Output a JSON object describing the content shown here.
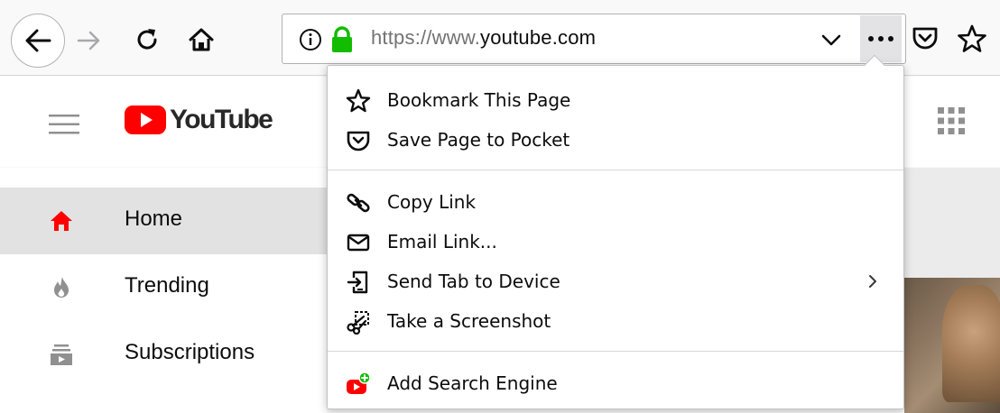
{
  "toolbar": {
    "url_scheme": "https://",
    "url_prefix": "www.",
    "url_domain": "youtube",
    "url_suffix": ".com"
  },
  "youtube": {
    "logo_text": "YouTube",
    "sidebar": [
      {
        "label": "Home",
        "icon": "home-icon",
        "active": true
      },
      {
        "label": "Trending",
        "icon": "trending-flame-icon",
        "active": false
      },
      {
        "label": "Subscriptions",
        "icon": "subscriptions-icon",
        "active": false
      }
    ]
  },
  "menu": {
    "items": [
      {
        "label": "Bookmark This Page",
        "icon": "star-icon"
      },
      {
        "label": "Save Page to Pocket",
        "icon": "pocket-icon"
      },
      {
        "label": "Copy Link",
        "icon": "link-icon"
      },
      {
        "label": "Email Link...",
        "icon": "email-icon"
      },
      {
        "label": "Send Tab to Device",
        "icon": "send-tab-icon"
      },
      {
        "label": "Take a Screenshot",
        "icon": "screenshot-icon"
      },
      {
        "label": "Add Search Engine",
        "icon": "add-search-engine-icon"
      }
    ]
  },
  "colors": {
    "youtube_red": "#ff0000",
    "lock_green": "#12bc00",
    "active_sidebar_bg": "#e2e2e2"
  }
}
